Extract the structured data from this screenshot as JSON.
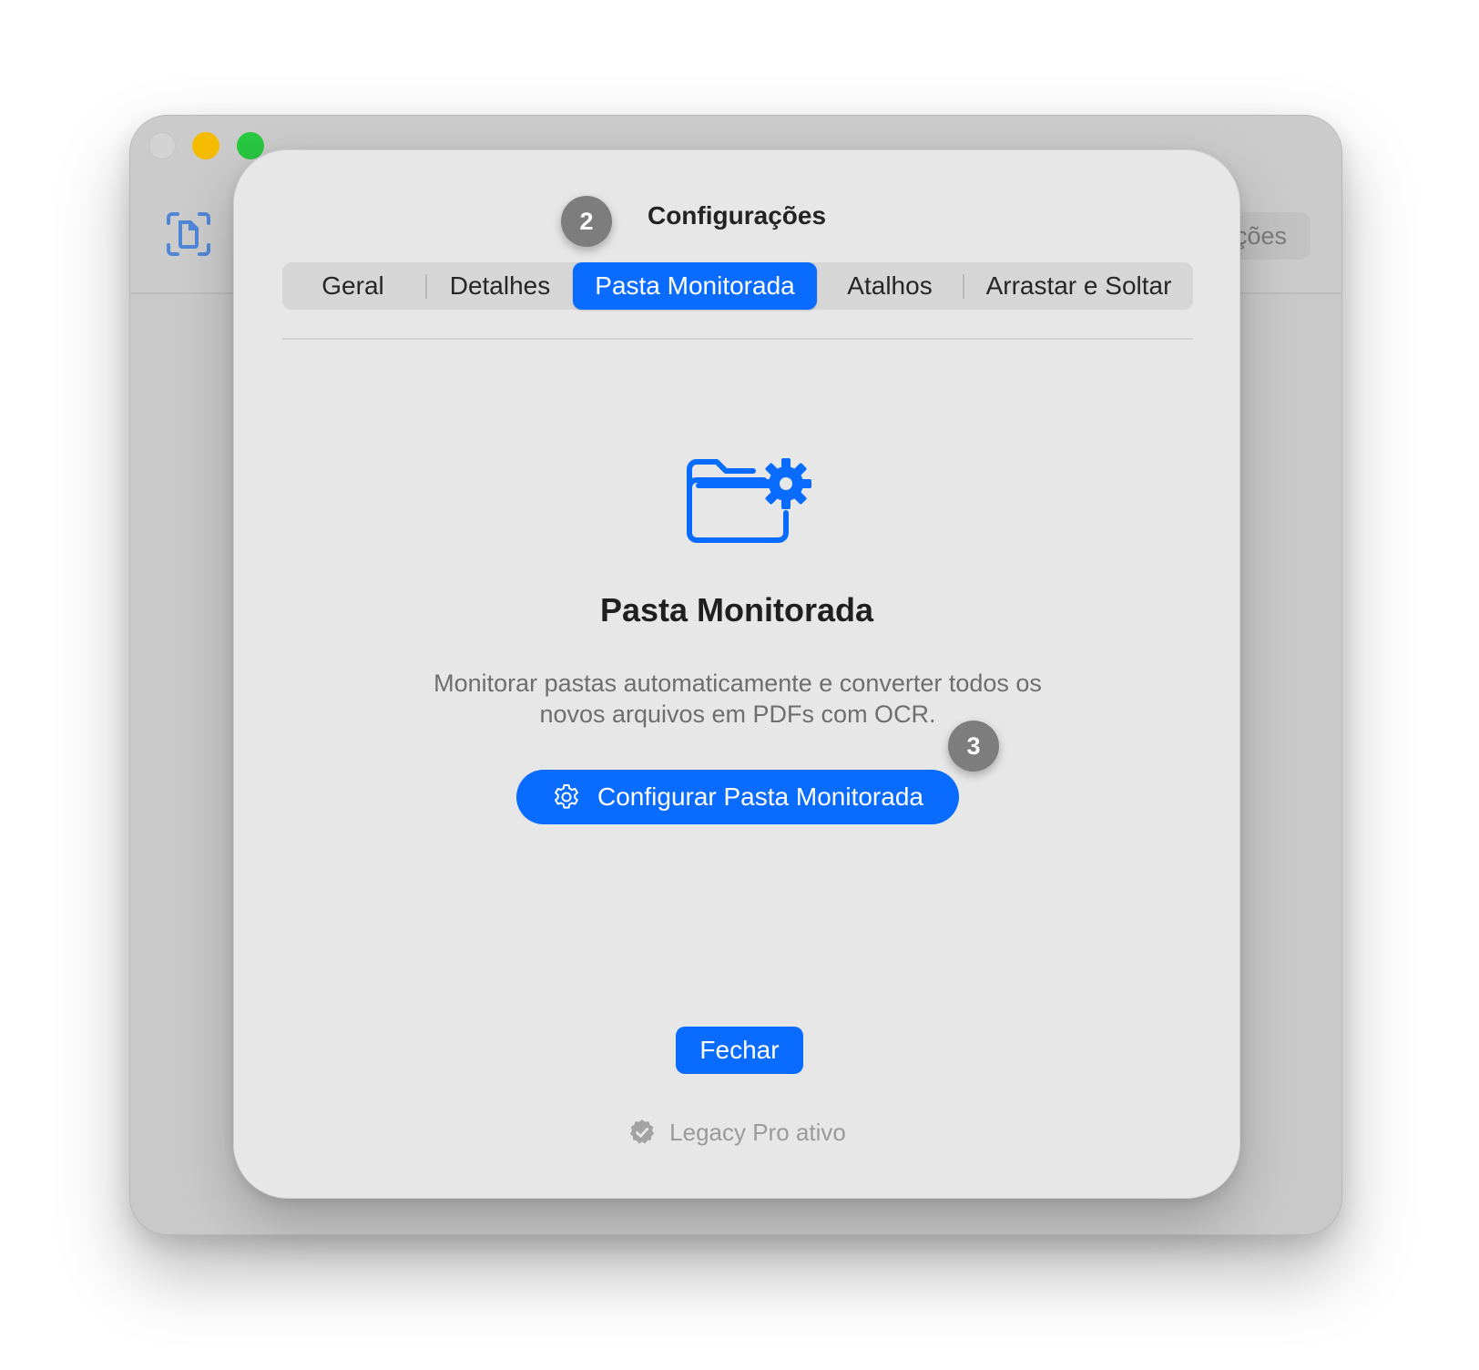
{
  "background_window": {
    "toolbar_button_label": "ções"
  },
  "sheet": {
    "title": "Configurações",
    "tabs": [
      {
        "label": "Geral",
        "selected": false
      },
      {
        "label": "Detalhes",
        "selected": false
      },
      {
        "label": "Pasta Monitorada",
        "selected": true
      },
      {
        "label": "Atalhos",
        "selected": false
      },
      {
        "label": "Arrastar e Soltar",
        "selected": false
      }
    ],
    "hero": {
      "icon": "folder-gear-icon",
      "title": "Pasta Monitorada",
      "description_line1": "Monitorar pastas automaticamente e converter todos os",
      "description_line2": "novos arquivos em PDFs com OCR."
    },
    "configure_button_label": "Configurar Pasta Monitorada",
    "close_button_label": "Fechar",
    "status_text": "Legacy Pro ativo"
  },
  "badges": {
    "step2": "2",
    "step3": "3"
  },
  "colors": {
    "accent": "#0a6cff",
    "sheet_bg": "#e7e7e7",
    "badge_bg": "#7d7d7d"
  }
}
